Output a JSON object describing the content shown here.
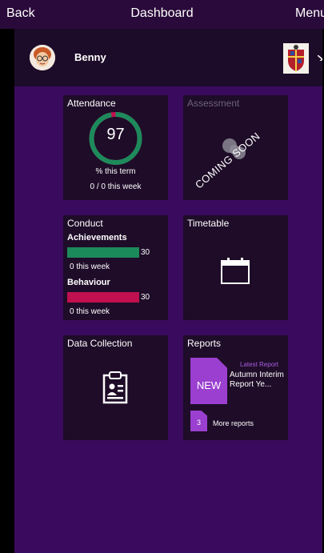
{
  "nav": {
    "back": "Back",
    "title": "Dashboard",
    "menu": "Menu"
  },
  "profile": {
    "name": "Benny"
  },
  "tiles": {
    "attendance": {
      "title": "Attendance",
      "value": "97",
      "percent": 0.97,
      "sub1": "% this term",
      "sub2": "0 / 0 this week"
    },
    "assessment": {
      "title": "Assessment",
      "overlay": "COMING SOON"
    },
    "conduct": {
      "title": "Conduct",
      "achievements": {
        "label": "Achievements",
        "value": "30",
        "week": "0 this week",
        "color": "#1d8a5c"
      },
      "behaviour": {
        "label": "Behaviour",
        "value": "30",
        "week": "0 this week",
        "color": "#c0104f"
      }
    },
    "timetable": {
      "title": "Timetable"
    },
    "data_collection": {
      "title": "Data Collection"
    },
    "reports": {
      "title": "Reports",
      "badge": "NEW",
      "latest_label": "Latest Report",
      "latest_name": "Autumn Interim Report Ye...",
      "more_count": "3",
      "more_label": "More reports"
    }
  },
  "colors": {
    "accent": "#9b3fd0",
    "background": "#3a0a5e",
    "tile": "#1e0c28",
    "ring_green": "#1d8a5c",
    "ring_red": "#c0104f"
  }
}
